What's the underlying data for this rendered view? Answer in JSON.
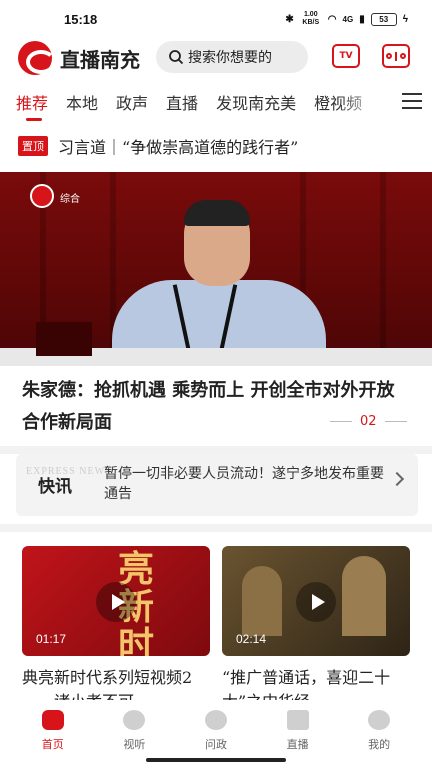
{
  "status": {
    "time": "15:18",
    "net_speed": "1.00 KB/S",
    "signal": "4G",
    "battery": "53"
  },
  "app": {
    "title": "直播南充",
    "search_placeholder": "搜索你想要的",
    "tv_label": "TV"
  },
  "tabs": [
    {
      "label": "推荐",
      "active": true
    },
    {
      "label": "本地"
    },
    {
      "label": "政声"
    },
    {
      "label": "直播"
    },
    {
      "label": "发现南充美"
    },
    {
      "label": "橙视频"
    }
  ],
  "pinned": {
    "badge": "置顶",
    "text": "习言道｜“争做崇高道德的践行者”"
  },
  "hero": {
    "channel_tag": "综合",
    "headline": "朱家德：抢抓机遇 乘势而上 开创全市对外开放合作新局面",
    "page": "02"
  },
  "flash": {
    "watermark": "EXPRESS NEWS",
    "title": "快讯",
    "text": "暂停一切非必要人员流动！遂宁多地发布重要通告"
  },
  "videos": [
    {
      "art": "亮新时代",
      "duration": "01:17",
      "title": "典亮新时代系列短视频2——诸小孝不可…"
    },
    {
      "art": "",
      "duration": "02:14",
      "title": "“推广普通话，喜迎二十大”之中华经…"
    }
  ],
  "nav": [
    {
      "label": "首页",
      "icon": "home-icon",
      "active": true
    },
    {
      "label": "视听",
      "icon": "play-circle-icon"
    },
    {
      "label": "问政",
      "icon": "chat-icon"
    },
    {
      "label": "直播",
      "icon": "video-camera-icon"
    },
    {
      "label": "我的",
      "icon": "profile-icon"
    }
  ],
  "colors": {
    "brand": "#d7141a"
  }
}
